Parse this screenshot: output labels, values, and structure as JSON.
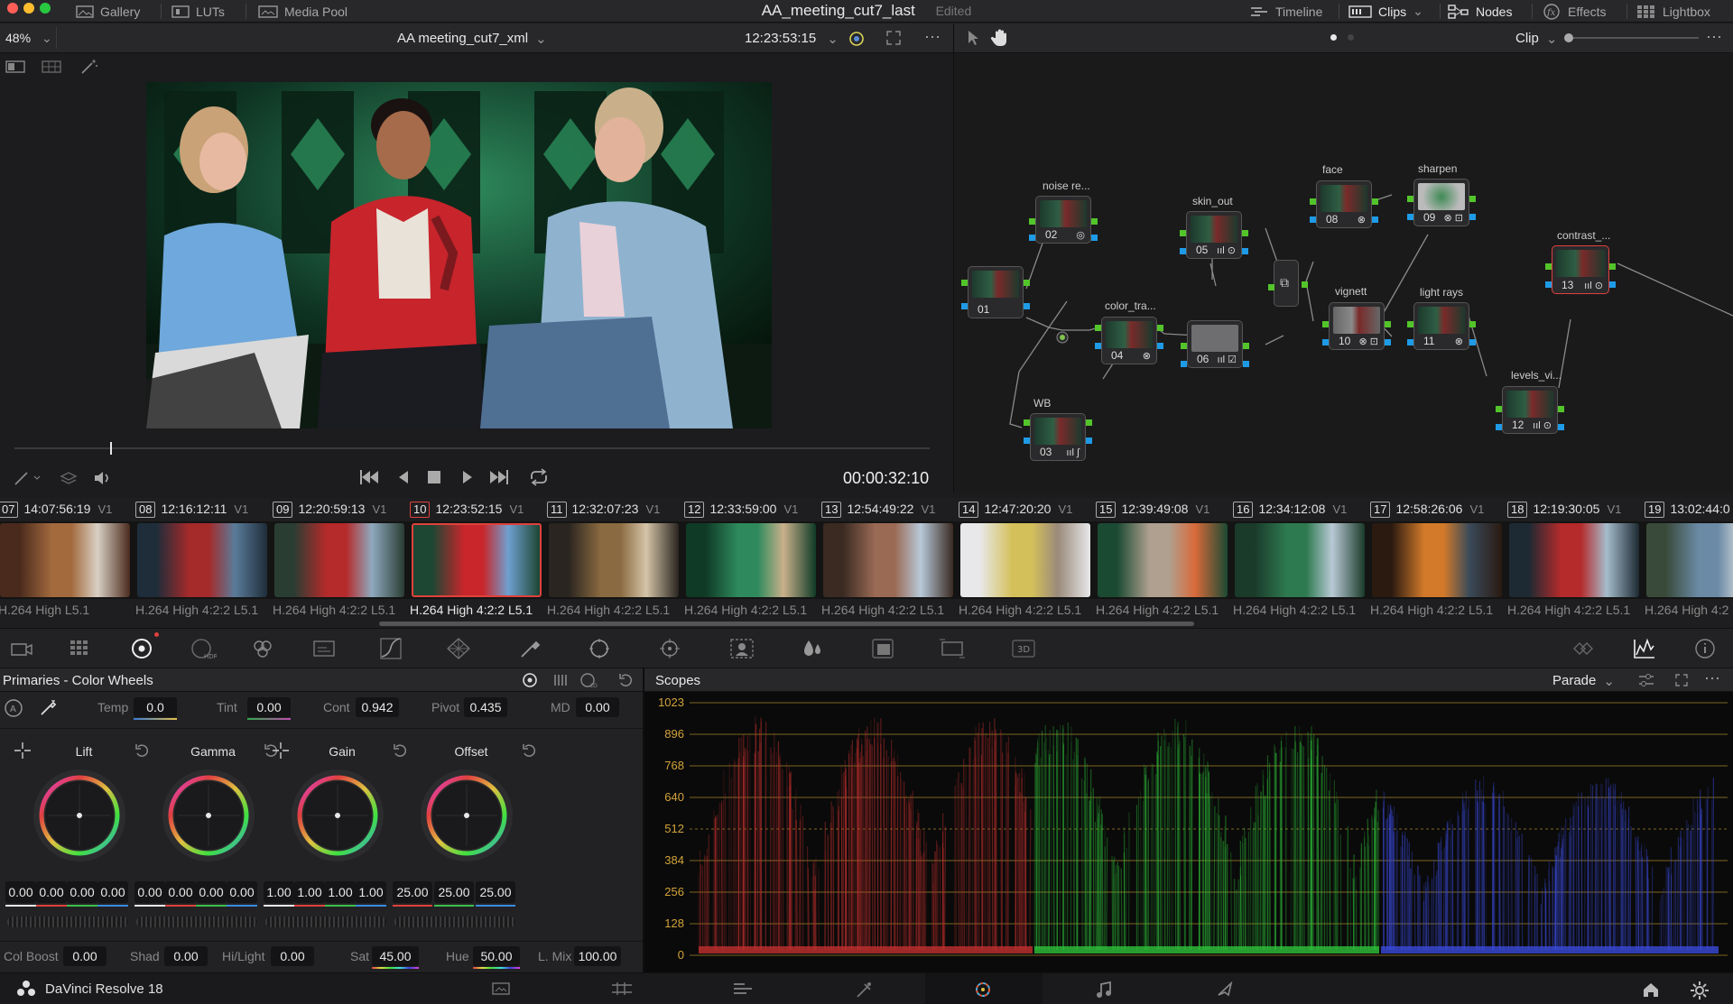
{
  "colors": {
    "accent_red": "#e0413c",
    "traffic_red": "#ff5f57",
    "traffic_yellow": "#febc2e",
    "traffic_green": "#28c840",
    "node_input_green": "#53c52b",
    "node_output_blue": "#1e9be6",
    "scope_gold": "#c8a334"
  },
  "topbar": {
    "gallery": "Gallery",
    "luts": "LUTs",
    "media_pool": "Media Pool",
    "title": "AA_meeting_cut7_last",
    "status": "Edited",
    "timeline": "Timeline",
    "clips": "Clips",
    "nodes": "Nodes",
    "effects": "Effects",
    "lightbox": "Lightbox"
  },
  "viewer": {
    "zoom": "48%",
    "timeline_name": "AA meeting_cut7_xml",
    "timecode": "12:23:53:15",
    "playhead_time": "00:00:32:10",
    "scrub_fraction": 0.105
  },
  "nodebar": {
    "mode": "Clip"
  },
  "nodes": [
    {
      "num": "01",
      "label": ""
    },
    {
      "num": "02",
      "label": "noise re..."
    },
    {
      "num": "03",
      "label": "WB"
    },
    {
      "num": "04",
      "label": "color_tra..."
    },
    {
      "num": "05",
      "label": "skin_out"
    },
    {
      "num": "06",
      "label": ""
    },
    {
      "num": "08",
      "label": "face"
    },
    {
      "num": "09",
      "label": "sharpen"
    },
    {
      "num": "10",
      "label": "vignett"
    },
    {
      "num": "11",
      "label": "light rays"
    },
    {
      "num": "12",
      "label": "levels_vi..."
    },
    {
      "num": "13",
      "label": "contrast_..."
    }
  ],
  "clips": [
    {
      "num": "07",
      "tc": "14:07:56:19",
      "track": "V1",
      "codec": "H.264 High L5.1"
    },
    {
      "num": "08",
      "tc": "12:16:12:11",
      "track": "V1",
      "codec": "H.264 High 4:2:2 L5.1"
    },
    {
      "num": "09",
      "tc": "12:20:59:13",
      "track": "V1",
      "codec": "H.264 High 4:2:2 L5.1"
    },
    {
      "num": "10",
      "tc": "12:23:52:15",
      "track": "V1",
      "codec": "H.264 High 4:2:2 L5.1"
    },
    {
      "num": "11",
      "tc": "12:32:07:23",
      "track": "V1",
      "codec": "H.264 High 4:2:2 L5.1"
    },
    {
      "num": "12",
      "tc": "12:33:59:00",
      "track": "V1",
      "codec": "H.264 High 4:2:2 L5.1"
    },
    {
      "num": "13",
      "tc": "12:54:49:22",
      "track": "V1",
      "codec": "H.264 High 4:2:2 L5.1"
    },
    {
      "num": "14",
      "tc": "12:47:20:20",
      "track": "V1",
      "codec": "H.264 High 4:2:2 L5.1"
    },
    {
      "num": "15",
      "tc": "12:39:49:08",
      "track": "V1",
      "codec": "H.264 High 4:2:2 L5.1"
    },
    {
      "num": "16",
      "tc": "12:34:12:08",
      "track": "V1",
      "codec": "H.264 High 4:2:2 L5.1"
    },
    {
      "num": "17",
      "tc": "12:58:26:06",
      "track": "V1",
      "codec": "H.264 High 4:2:2 L5.1"
    },
    {
      "num": "18",
      "tc": "12:19:30:05",
      "track": "V1",
      "codec": "H.264 High 4:2:2 L5.1"
    },
    {
      "num": "19",
      "tc": "13:02:44:0",
      "track": "",
      "codec": "H.264 High 4:2"
    }
  ],
  "primaries": {
    "title": "Primaries - Color Wheels",
    "temp_label": "Temp",
    "temp": "0.0",
    "tint_label": "Tint",
    "tint": "0.00",
    "cont_label": "Cont",
    "cont": "0.942",
    "pivot_label": "Pivot",
    "pivot": "0.435",
    "md_label": "MD",
    "md": "0.00",
    "wheels": [
      {
        "name": "Lift",
        "values": [
          "0.00",
          "0.00",
          "0.00",
          "0.00"
        ]
      },
      {
        "name": "Gamma",
        "values": [
          "0.00",
          "0.00",
          "0.00",
          "0.00"
        ]
      },
      {
        "name": "Gain",
        "values": [
          "1.00",
          "1.00",
          "1.00",
          "1.00"
        ]
      },
      {
        "name": "Offset",
        "values": [
          "25.00",
          "25.00",
          "25.00"
        ]
      }
    ],
    "colboost_label": "Col Boost",
    "colboost": "0.00",
    "shad_label": "Shad",
    "shad": "0.00",
    "hilight_label": "Hi/Light",
    "hilight": "0.00",
    "sat_label": "Sat",
    "sat": "45.00",
    "hue_label": "Hue",
    "hue": "50.00",
    "lmix_label": "L. Mix",
    "lmix": "100.00"
  },
  "scopes": {
    "title": "Scopes",
    "mode": "Parade",
    "ticks": [
      "1023",
      "896",
      "768",
      "640",
      "512",
      "384",
      "256",
      "128",
      "0"
    ]
  },
  "app": {
    "name": "DaVinci Resolve 18"
  }
}
